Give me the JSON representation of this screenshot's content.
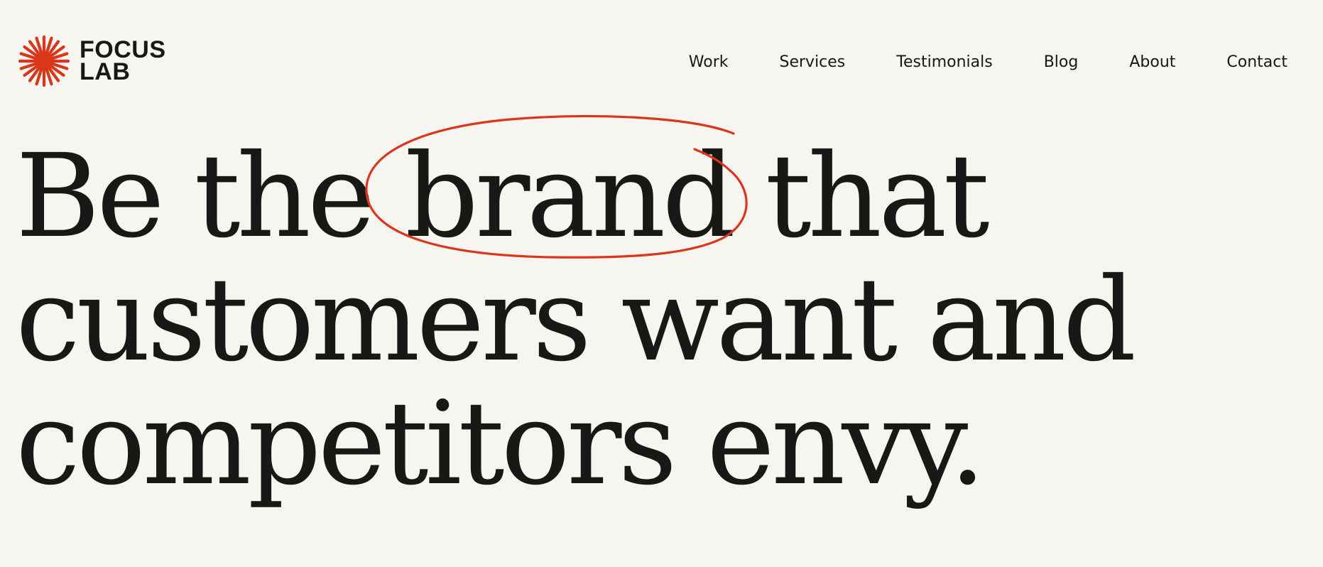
{
  "brand": {
    "name_line1": "FOCUS",
    "name_line2": "LAB",
    "accent_color": "#d9361c",
    "icon": "sunburst-logo-icon"
  },
  "nav": {
    "items": [
      {
        "label": "Work"
      },
      {
        "label": "Services"
      },
      {
        "label": "Testimonials"
      },
      {
        "label": "Blog"
      },
      {
        "label": "About"
      },
      {
        "label": "Contact"
      }
    ]
  },
  "hero": {
    "line1_before": "Be the ",
    "line1_highlight": "brand",
    "line1_after": " that",
    "line2": "customers want and",
    "line3": "competitors envy.",
    "highlight_style": "hand-drawn-circle"
  }
}
